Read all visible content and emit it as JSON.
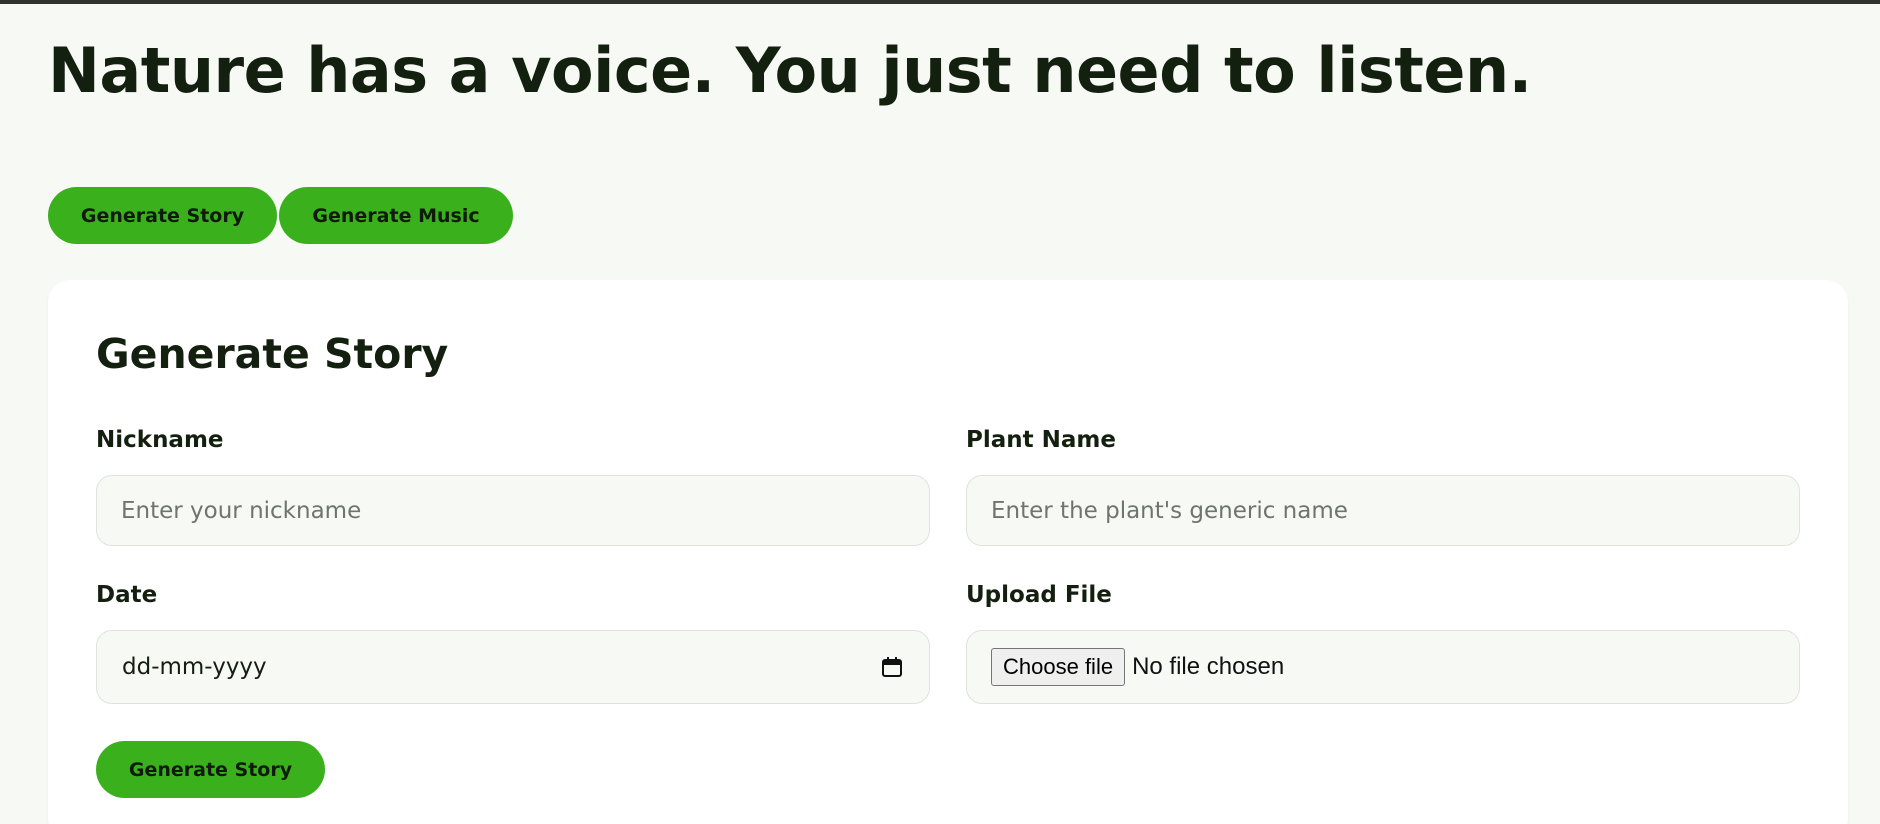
{
  "hero": {
    "title": "Nature has a voice. You just need to listen."
  },
  "tabs": [
    {
      "label": "Generate Story"
    },
    {
      "label": "Generate Music"
    }
  ],
  "form": {
    "title": "Generate Story",
    "nickname": {
      "label": "Nickname",
      "placeholder": "Enter your nickname",
      "value": ""
    },
    "plant_name": {
      "label": "Plant Name",
      "placeholder": "Enter the plant's generic name",
      "value": ""
    },
    "date": {
      "label": "Date",
      "value": "dd-mm-yyyy",
      "icon": "calendar-icon"
    },
    "upload": {
      "label": "Upload File",
      "button_label": "Choose file",
      "status": "No file chosen"
    },
    "submit_label": "Generate Story"
  },
  "colors": {
    "accent": "#3bb01d",
    "background": "#f7f9f5",
    "card": "#ffffff",
    "text": "#14200f"
  }
}
